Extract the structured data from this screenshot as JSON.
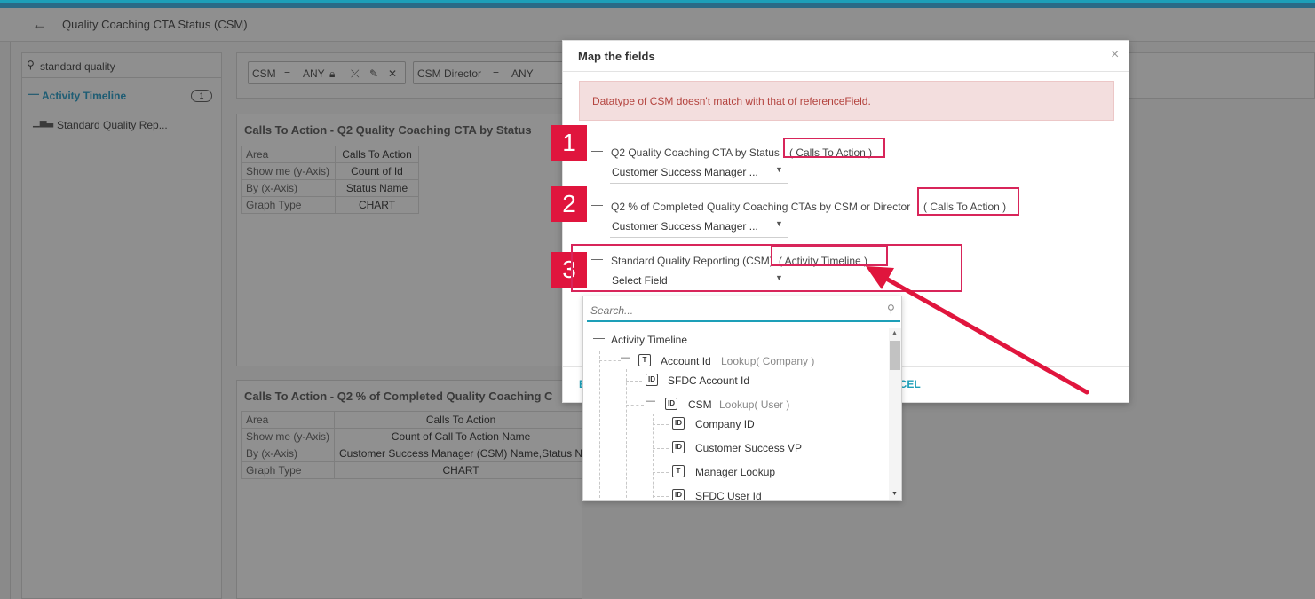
{
  "app": {
    "title": "Quality Coaching CTA Status (CSM)",
    "collapse_glyph": "»"
  },
  "sidebar": {
    "search_value": "standard quality",
    "group_label": "Activity Timeline",
    "group_count": "1",
    "items": [
      {
        "label": "Standard Quality Rep..."
      }
    ]
  },
  "filters": [
    {
      "field": "CSM",
      "op": "=",
      "value": "ANY"
    },
    {
      "field": "CSM Director",
      "op": "=",
      "value": "ANY"
    }
  ],
  "cards": [
    {
      "title": "Calls To Action - Q2 Quality Coaching CTA by Status",
      "rows": [
        {
          "key": "Area",
          "value": "Calls To Action"
        },
        {
          "key": "Show me (y-Axis)",
          "value": "Count of Id"
        },
        {
          "key": "By (x-Axis)",
          "value": "Status Name"
        },
        {
          "key": "Graph Type",
          "value": "CHART"
        }
      ]
    },
    {
      "title": "Calls To Action - Q2 % of Completed Quality Coaching C",
      "rows": [
        {
          "key": "Area",
          "value": "Calls To Action"
        },
        {
          "key": "Show me (y-Axis)",
          "value": "Count of Call To Action Name"
        },
        {
          "key": "By (x-Axis)",
          "value": "Customer Success Manager (CSM) Name,Status N"
        },
        {
          "key": "Graph Type",
          "value": "CHART"
        }
      ]
    }
  ],
  "modal": {
    "title": "Map the fields",
    "close": "×",
    "alert": "Datatype of CSM doesn't match with that of referenceField.",
    "mappings": [
      {
        "label": "Q2 Quality Coaching CTA by Status",
        "ref": "( Calls To Action )",
        "select": "Customer Success Manager ..."
      },
      {
        "label": "Q2 % of Completed Quality Coaching CTAs by CSM or Director",
        "ref": "( Calls To Action )",
        "select": "Customer Success Manager ..."
      },
      {
        "label": "Standard Quality Reporting (CSM)",
        "ref": "( Activity Timeline )",
        "select": "Select Field"
      }
    ],
    "footer_left": "E",
    "footer_right": "NCEL"
  },
  "dropdown": {
    "placeholder": "Search...",
    "root": "Activity Timeline",
    "items": [
      {
        "label": "Account Id",
        "type": "T",
        "sub": "Lookup( Company )"
      },
      {
        "label": "SFDC Account Id",
        "type": "ID"
      },
      {
        "label": "CSM",
        "type": "ID",
        "sub": "Lookup( User )"
      },
      {
        "label": "Company ID",
        "type": "ID"
      },
      {
        "label": "Customer Success VP",
        "type": "ID"
      },
      {
        "label": "Manager Lookup",
        "type": "T"
      },
      {
        "label": "SFDC User Id",
        "type": "ID"
      }
    ]
  },
  "annotations": {
    "numbers": [
      "1",
      "2",
      "3"
    ],
    "color": "#e0153d"
  }
}
